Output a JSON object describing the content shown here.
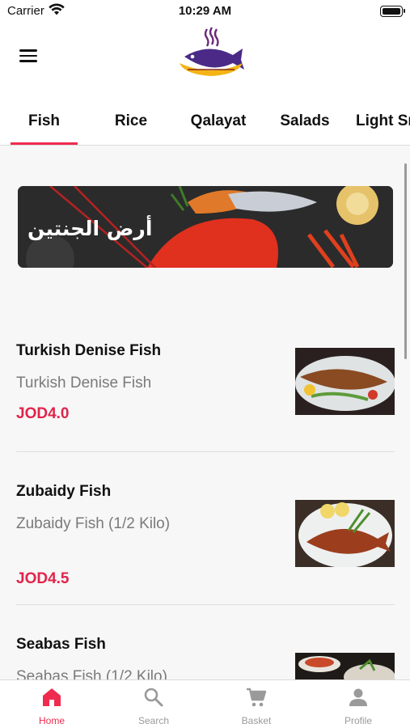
{
  "status": {
    "carrier": "Carrier",
    "time": "10:29 AM"
  },
  "header": {
    "menu_icon": "menu-icon",
    "logo_icon": "fish-plate-logo"
  },
  "tabs": [
    {
      "label": "Fish",
      "active": true
    },
    {
      "label": "Rice",
      "active": false
    },
    {
      "label": "Qalayat",
      "active": false
    },
    {
      "label": "Salads",
      "active": false
    },
    {
      "label": "Light Sr",
      "active": false
    }
  ],
  "banner": {
    "text": "أرض الجنتين"
  },
  "items": [
    {
      "name": "Turkish Denise Fish",
      "description": "Turkish Denise Fish",
      "price": "JOD4.0"
    },
    {
      "name": "Zubaidy Fish",
      "description": "Zubaidy Fish (1/2 Kilo)",
      "price": "JOD4.5"
    },
    {
      "name": "Seabas Fish",
      "description": "Seabas Fish (1/2 Kilo)",
      "price": ""
    }
  ],
  "tabbar": [
    {
      "label": "Home",
      "icon": "home-icon",
      "active": true
    },
    {
      "label": "Search",
      "icon": "search-icon",
      "active": false
    },
    {
      "label": "Basket",
      "icon": "cart-icon",
      "active": false
    },
    {
      "label": "Profile",
      "icon": "person-icon",
      "active": false
    }
  ],
  "colors": {
    "accent": "#ef2b4f",
    "price": "#e0244b",
    "background": "#f7f7f7"
  }
}
